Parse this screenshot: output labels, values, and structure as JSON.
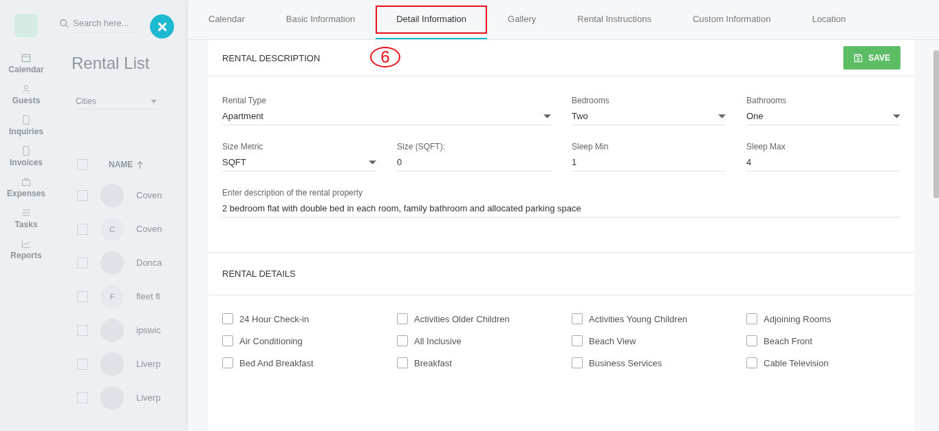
{
  "background": {
    "search": {
      "placeholder": "Search here..."
    },
    "nav": [
      {
        "label": "Calendar"
      },
      {
        "label": "Guests"
      },
      {
        "label": "Inquiries"
      },
      {
        "label": "Invoices"
      },
      {
        "label": "Expenses"
      },
      {
        "label": "Tasks"
      },
      {
        "label": "Reports"
      }
    ],
    "title": "Rental List",
    "filter": {
      "placeholder": "Cities"
    },
    "column": "NAME",
    "select_all": {
      "checked": false
    },
    "rows": [
      {
        "kind": "photo",
        "name": "Coven",
        "checked": false
      },
      {
        "kind": "letter",
        "letter": "C",
        "name": "Coven",
        "checked": false
      },
      {
        "kind": "photo",
        "name": "Donca",
        "checked": false
      },
      {
        "kind": "letter",
        "letter": "F",
        "name": "fleet fl",
        "checked": false
      },
      {
        "kind": "photo",
        "name": "ipswic",
        "checked": false
      },
      {
        "kind": "photo",
        "name": "Liverp",
        "checked": false
      },
      {
        "kind": "photo",
        "name": "Liverp",
        "checked": false
      }
    ]
  },
  "tabs": [
    {
      "label": "Calendar",
      "selected": false
    },
    {
      "label": "Basic Information",
      "selected": false
    },
    {
      "label": "Detail Information",
      "selected": true
    },
    {
      "label": "Gallery",
      "selected": false
    },
    {
      "label": "Rental Instructions",
      "selected": false
    },
    {
      "label": "Custom Information",
      "selected": false
    },
    {
      "label": "Location",
      "selected": false
    }
  ],
  "annotation": {
    "label": "6"
  },
  "description": {
    "title": "RENTAL DESCRIPTION",
    "save": "SAVE",
    "fields": [
      {
        "label": "Rental Type",
        "value": "Apartment",
        "kind": "select"
      },
      {
        "label": "Bedrooms",
        "value": "Two",
        "kind": "select"
      },
      {
        "label": "Bathrooms",
        "value": "One",
        "kind": "select"
      },
      {
        "label": "Size Metric",
        "value": "SQFT",
        "kind": "select"
      },
      {
        "label": "Size (SQFT):",
        "value": "0",
        "kind": "text"
      },
      {
        "label": "Sleep Min",
        "value": "1",
        "kind": "text"
      },
      {
        "label": "Sleep Max",
        "value": "4",
        "kind": "text"
      },
      {
        "label": "Enter description of the rental property",
        "value": "2 bedroom flat with double bed in each room, family bathroom and allocated parking space",
        "kind": "text"
      }
    ]
  },
  "details": {
    "title": "RENTAL DETAILS",
    "amenities": [
      {
        "label": "24 Hour Check-in",
        "checked": false
      },
      {
        "label": "Activities Older Children",
        "checked": false
      },
      {
        "label": "Activities Young Children",
        "checked": false
      },
      {
        "label": "Adjoining Rooms",
        "checked": false
      },
      {
        "label": "Air Conditioning",
        "checked": false
      },
      {
        "label": "All Inclusive",
        "checked": false
      },
      {
        "label": "Beach View",
        "checked": false
      },
      {
        "label": "Beach Front",
        "checked": false
      },
      {
        "label": "Bed And Breakfast",
        "checked": false
      },
      {
        "label": "Breakfast",
        "checked": false
      },
      {
        "label": "Business Services",
        "checked": false
      },
      {
        "label": "Cable Television",
        "checked": false
      }
    ]
  }
}
